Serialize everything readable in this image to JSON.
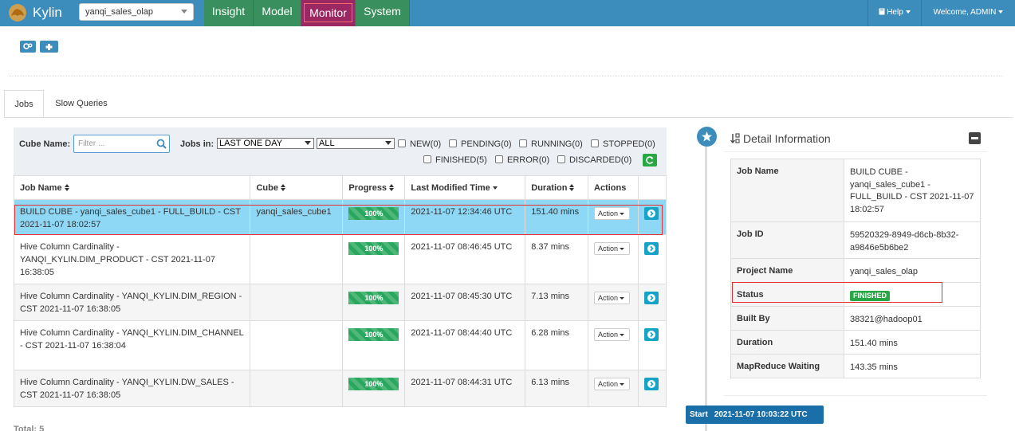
{
  "app": {
    "brand": "Kylin",
    "project": "yanqi_sales_olap"
  },
  "nav": {
    "insight": "Insight",
    "model": "Model",
    "monitor": "Monitor",
    "system": "System"
  },
  "topright": {
    "help": "Help",
    "welcome": "Welcome, ADMIN"
  },
  "tabs": {
    "jobs": "Jobs",
    "slow": "Slow Queries"
  },
  "filters": {
    "cube_label": "Cube Name:",
    "cube_placeholder": "Filter ...",
    "jobs_in_label": "Jobs in:",
    "time_range": "LAST ONE DAY",
    "job_type": "ALL",
    "statuses": [
      "NEW(0)",
      "PENDING(0)",
      "RUNNING(0)",
      "STOPPED(0)",
      "FINISHED(5)",
      "ERROR(0)",
      "DISCARDED(0)"
    ]
  },
  "table": {
    "headers": {
      "job_name": "Job Name",
      "cube": "Cube",
      "progress": "Progress",
      "modified": "Last Modified Time",
      "duration": "Duration",
      "actions": "Actions"
    },
    "action_label": "Action",
    "rows": [
      {
        "name": "BUILD CUBE - yanqi_sales_cube1 - FULL_BUILD - CST 2021-11-07 18:02:57",
        "cube": "yanqi_sales_cube1",
        "progress": "100%",
        "modified": "2021-11-07 12:34:46 UTC",
        "duration": "151.40 mins"
      },
      {
        "name": "Hive Column Cardinality - YANQI_KYLIN.DIM_PRODUCT - CST 2021-11-07 16:38:05",
        "cube": "",
        "progress": "100%",
        "modified": "2021-11-07 08:46:45 UTC",
        "duration": "8.37 mins"
      },
      {
        "name": "Hive Column Cardinality - YANQI_KYLIN.DIM_REGION - CST 2021-11-07 16:38:05",
        "cube": "",
        "progress": "100%",
        "modified": "2021-11-07 08:45:30 UTC",
        "duration": "7.13 mins"
      },
      {
        "name": "Hive Column Cardinality - YANQI_KYLIN.DIM_CHANNEL - CST 2021-11-07 16:38:04",
        "cube": "",
        "progress": "100%",
        "modified": "2021-11-07 08:44:40 UTC",
        "duration": "6.28 mins"
      },
      {
        "name": "Hive Column Cardinality - YANQI_KYLIN.DW_SALES - CST 2021-11-07 16:38:05",
        "cube": "",
        "progress": "100%",
        "modified": "2021-11-07 08:44:31 UTC",
        "duration": "6.13 mins"
      }
    ]
  },
  "total": "Total: 5",
  "detail": {
    "title": "Detail Information",
    "fields": [
      {
        "key": "Job Name",
        "value": "BUILD CUBE - yanqi_sales_cube1 - FULL_BUILD - CST 2021-11-07 18:02:57"
      },
      {
        "key": "Job ID",
        "value": "59520329-8949-d6cb-8b32-a9846e5b6be2"
      },
      {
        "key": "Project Name",
        "value": "yanqi_sales_olap"
      },
      {
        "key": "Status",
        "value": "FINISHED"
      },
      {
        "key": "Built By",
        "value": "38321@hadoop01"
      },
      {
        "key": "Duration",
        "value": "151.40 mins"
      },
      {
        "key": "MapReduce Waiting",
        "value": "143.35 mins"
      }
    ],
    "start_label": "Start",
    "start_time": "2021-11-07 10:03:22 UTC"
  },
  "colors": {
    "navbar": "#3c8dbc",
    "nav_item": "#3a8f5e",
    "nav_active": "#9b2862",
    "selected_row": "#8ed7f5",
    "success": "#28a745"
  }
}
